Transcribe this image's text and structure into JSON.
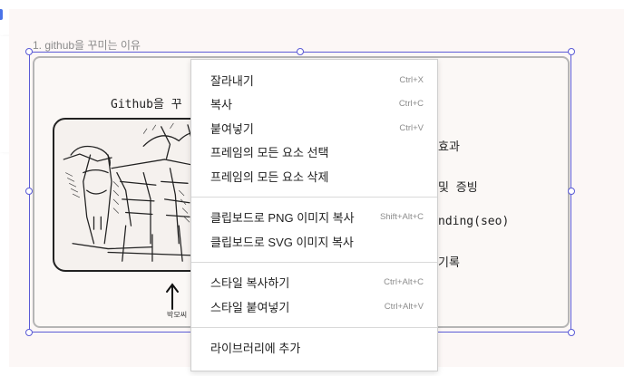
{
  "frame": {
    "label": "1. github을 꾸미는 이유",
    "title": "Github을 꾸",
    "items": [
      "효과",
      "및 증빙",
      "nding(seo)",
      "기록"
    ],
    "sketch_caption": "박모씨"
  },
  "context_menu": {
    "groups": [
      [
        {
          "label": "잘라내기",
          "shortcut": "Ctrl+X"
        },
        {
          "label": "복사",
          "shortcut": "Ctrl+C"
        },
        {
          "label": "붙여넣기",
          "shortcut": "Ctrl+V"
        },
        {
          "label": "프레임의 모든 요소 선택",
          "shortcut": ""
        },
        {
          "label": "프레임의 모든 요소 삭제",
          "shortcut": ""
        }
      ],
      [
        {
          "label": "클립보드로 PNG 이미지 복사",
          "shortcut": "Shift+Alt+C",
          "highlighted": true
        },
        {
          "label": "클립보드로 SVG 이미지 복사",
          "shortcut": ""
        }
      ],
      [
        {
          "label": "스타일 복사하기",
          "shortcut": "Ctrl+Alt+C"
        },
        {
          "label": "스타일 붙여넣기",
          "shortcut": "Ctrl+Alt+V"
        }
      ],
      [
        {
          "label": "라이브러리에 추가",
          "shortcut": ""
        }
      ]
    ],
    "highlight_color": "#f7f32a"
  },
  "colors": {
    "selection": "#5b5bd6",
    "canvas": "#fcf7f6"
  }
}
